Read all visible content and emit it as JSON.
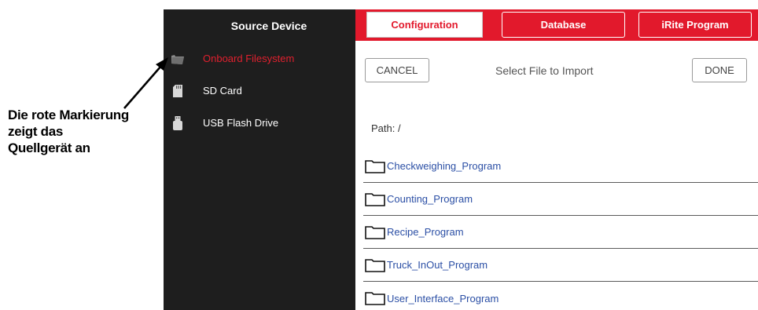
{
  "annotation": {
    "line1": "Die rote Markierung",
    "line2": "zeigt das",
    "line3": "Quellgerät an"
  },
  "sidebar": {
    "title": "Source Device",
    "items": [
      {
        "label": "Onboard Filesystem",
        "icon": "folder-icon",
        "active": true
      },
      {
        "label": "SD Card",
        "icon": "sd-card-icon",
        "active": false
      },
      {
        "label": "USB Flash Drive",
        "icon": "usb-drive-icon",
        "active": false
      }
    ]
  },
  "tabs": [
    {
      "label": "Configuration",
      "selected": true
    },
    {
      "label": "Database",
      "selected": false
    },
    {
      "label": "iRite Program",
      "selected": false
    }
  ],
  "dialog": {
    "cancel_label": "CANCEL",
    "title": "Select File to Import",
    "done_label": "DONE",
    "path": "Path: /"
  },
  "files": [
    {
      "name": "Checkweighing_Program",
      "icon": "folder-icon"
    },
    {
      "name": "Counting_Program",
      "icon": "folder-icon"
    },
    {
      "name": "Recipe_Program",
      "icon": "folder-icon"
    },
    {
      "name": "Truck_InOut_Program",
      "icon": "folder-icon"
    },
    {
      "name": "User_Interface_Program",
      "icon": "folder-icon"
    }
  ],
  "colors": {
    "accent_red": "#e2192c",
    "sidebar_bg": "#1e1e1e",
    "link_blue": "#2b4fa5"
  }
}
